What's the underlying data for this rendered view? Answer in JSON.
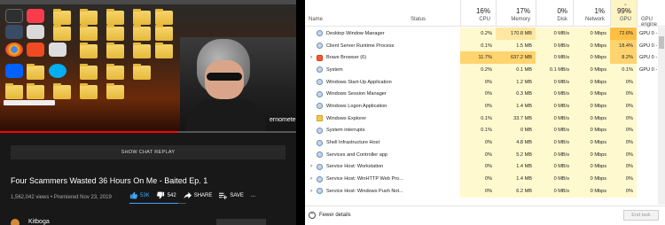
{
  "youtube": {
    "chat_replay_label": "SHOW CHAT REPLAY",
    "title": "Four Scammers Wasted 36 Hours On Me - Baited Ep. 1",
    "views": "1,562,042 views",
    "premiered": "Premiered Nov 23, 2019",
    "like_count": "53K",
    "dislike_count": "542",
    "share_label": "SHARE",
    "save_label": "SAVE",
    "more_label": "...",
    "channel_name": "Kitboga",
    "overlay_name": "ernometer",
    "like_ratio": 0.86,
    "accent": "#3ea6ff",
    "progress_color": "#ff0000"
  },
  "task_manager": {
    "columns": {
      "name": "Name",
      "status": "Status",
      "cpu": {
        "pct": "16%",
        "label": "CPU"
      },
      "memory": {
        "pct": "17%",
        "label": "Memory"
      },
      "disk": {
        "pct": "0%",
        "label": "Disk"
      },
      "network": {
        "pct": "1%",
        "label": "Network"
      },
      "gpu": {
        "pct": "99%",
        "label": "GPU"
      },
      "gpu_engine": "GPU engine"
    },
    "rows": [
      {
        "name": "Desktop Window Manager",
        "cpu": "0.2%",
        "mem": "170.8 MB",
        "disk": "0 MB/s",
        "net": "0 Mbps",
        "gpu": "72.6%",
        "eng": "GPU 0 - 3D",
        "expand": ""
      },
      {
        "name": "Client Server Runtime Process",
        "cpu": "0.1%",
        "mem": "1.5 MB",
        "disk": "0 MB/s",
        "net": "0 Mbps",
        "gpu": "18.4%",
        "eng": "GPU 0 - 3D",
        "expand": ""
      },
      {
        "name": "Brave Browser (6)",
        "cpu": "11.7%",
        "mem": "637.2 MB",
        "disk": "0 MB/s",
        "net": "0 Mbps",
        "gpu": "8.2%",
        "eng": "GPU 0 - 3D",
        "expand": ">"
      },
      {
        "name": "System",
        "cpu": "0.2%",
        "mem": "0.1 MB",
        "disk": "0.1 MB/s",
        "net": "0 Mbps",
        "gpu": "0.1%",
        "eng": "GPU 0 - 3D",
        "expand": ""
      },
      {
        "name": "Windows Start-Up Application",
        "cpu": "0%",
        "mem": "1.2 MB",
        "disk": "0 MB/s",
        "net": "0 Mbps",
        "gpu": "0%",
        "eng": "",
        "expand": ""
      },
      {
        "name": "Windows Session Manager",
        "cpu": "0%",
        "mem": "0.3 MB",
        "disk": "0 MB/s",
        "net": "0 Mbps",
        "gpu": "0%",
        "eng": "",
        "expand": ""
      },
      {
        "name": "Windows Logon Application",
        "cpu": "0%",
        "mem": "1.4 MB",
        "disk": "0 MB/s",
        "net": "0 Mbps",
        "gpu": "0%",
        "eng": "",
        "expand": ""
      },
      {
        "name": "Windows Explorer",
        "cpu": "0.1%",
        "mem": "33.7 MB",
        "disk": "0 MB/s",
        "net": "0 Mbps",
        "gpu": "0%",
        "eng": "",
        "expand": ""
      },
      {
        "name": "System interrupts",
        "cpu": "0.1%",
        "mem": "0 MB",
        "disk": "0 MB/s",
        "net": "0 Mbps",
        "gpu": "0%",
        "eng": "",
        "expand": ""
      },
      {
        "name": "Shell Infrastructure Host",
        "cpu": "0%",
        "mem": "4.8 MB",
        "disk": "0 MB/s",
        "net": "0 Mbps",
        "gpu": "0%",
        "eng": "",
        "expand": ""
      },
      {
        "name": "Services and Controller app",
        "cpu": "0%",
        "mem": "5.2 MB",
        "disk": "0 MB/s",
        "net": "0 Mbps",
        "gpu": "0%",
        "eng": "",
        "expand": ""
      },
      {
        "name": "Service Host: Workstation",
        "cpu": "0%",
        "mem": "1.4 MB",
        "disk": "0 MB/s",
        "net": "0 Mbps",
        "gpu": "0%",
        "eng": "",
        "expand": ">"
      },
      {
        "name": "Service Host: WinHTTP Web Pro...",
        "cpu": "0%",
        "mem": "1.4 MB",
        "disk": "0 MB/s",
        "net": "0 Mbps",
        "gpu": "0%",
        "eng": "",
        "expand": ">"
      },
      {
        "name": "Service Host: Windows Push Not...",
        "cpu": "0%",
        "mem": "6.2 MB",
        "disk": "0 MB/s",
        "net": "0 Mbps",
        "gpu": "0%",
        "eng": "",
        "expand": ">"
      }
    ],
    "fewer_details": "Fewer details",
    "end_task": "End task"
  }
}
